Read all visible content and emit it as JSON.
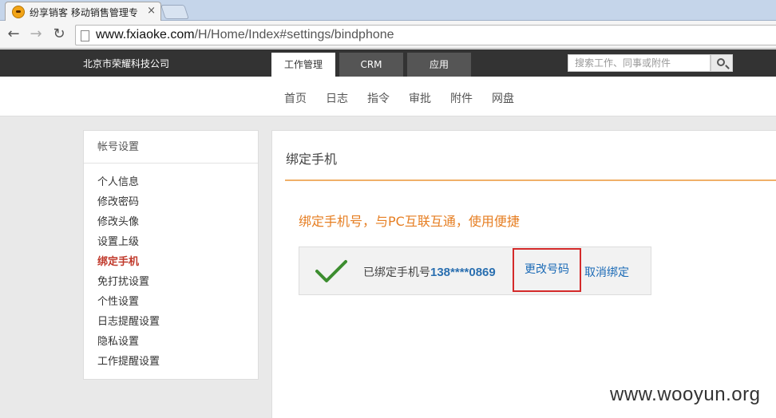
{
  "browser": {
    "tab_title": "纷享销客 移动销售管理专",
    "tab_close": "×",
    "url_host": "www.fxiaoke.com",
    "url_path": "/H/Home/Index#settings/bindphone",
    "back": "←",
    "forward": "→",
    "reload": "↻"
  },
  "header": {
    "company": "北京市荣耀科技公司",
    "tabs": [
      {
        "label": "工作管理"
      },
      {
        "label": "CRM"
      },
      {
        "label": "应用"
      }
    ],
    "search_placeholder": "搜索工作、同事或附件"
  },
  "subnav": {
    "items": [
      {
        "label": "首页"
      },
      {
        "label": "日志"
      },
      {
        "label": "指令"
      },
      {
        "label": "审批"
      },
      {
        "label": "附件"
      },
      {
        "label": "网盘"
      }
    ]
  },
  "sidebar": {
    "title": "帐号设置",
    "items": [
      {
        "label": "个人信息"
      },
      {
        "label": "修改密码"
      },
      {
        "label": "修改头像"
      },
      {
        "label": "设置上级"
      },
      {
        "label": "绑定手机"
      },
      {
        "label": "免打扰设置"
      },
      {
        "label": "个性设置"
      },
      {
        "label": "日志提醒设置"
      },
      {
        "label": "隐私设置"
      },
      {
        "label": "工作提醒设置"
      }
    ],
    "active_item": "绑定手机"
  },
  "main": {
    "title": "绑定手机",
    "promo": "绑定手机号，与PC互联互通，使用便捷",
    "bound_label": "已绑定手机号",
    "phone": "138****0869",
    "change_label": "更改号码",
    "unbind_label": "取消绑定"
  },
  "watermark": "www.wooyun.org",
  "colors": {
    "accent_orange": "#e67e22",
    "link_blue": "#1b6ab6",
    "active_red": "#c0392b",
    "highlight_red": "#d42a2a",
    "check_green": "#3c8d2f",
    "header_dark": "#333333"
  }
}
